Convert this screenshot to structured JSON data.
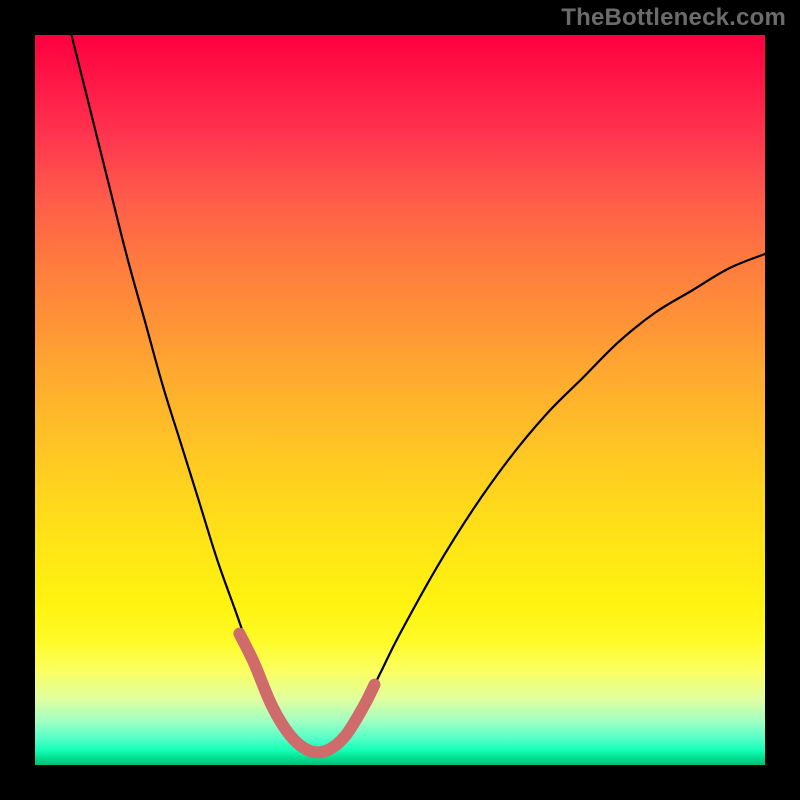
{
  "watermark": "TheBottleneck.com",
  "chart_data": {
    "type": "line",
    "title": "",
    "xlabel": "",
    "ylabel": "",
    "xlim": [
      0,
      100
    ],
    "ylim": [
      0,
      100
    ],
    "grid": false,
    "legend": false,
    "description": "Bottleneck percentage curve: V-shaped curve that dips to near 0% at the optimum around x≈37.5 and rises steeply on both sides. Background is a vertical red→yellow→green gradient (red at top = high bottleneck, green at bottom = low bottleneck). A thick salmon overlay highlights the near-optimal flat region roughly between x≈30 and x≈45.",
    "series": [
      {
        "name": "bottleneck-curve",
        "x": [
          5,
          7.5,
          10,
          12.5,
          15,
          17.5,
          20,
          22.5,
          25,
          27.5,
          30,
          32.5,
          35,
          37.5,
          40,
          42.5,
          45,
          47.5,
          50,
          55,
          60,
          65,
          70,
          75,
          80,
          85,
          90,
          95,
          100
        ],
        "y": [
          100,
          90,
          80,
          70,
          61,
          52,
          44,
          36,
          28,
          21,
          14,
          8,
          4,
          2,
          2,
          4,
          8,
          13,
          18,
          27,
          35,
          42,
          48,
          53,
          58,
          62,
          65,
          68,
          70
        ]
      },
      {
        "name": "optimal-zone-highlight",
        "x": [
          28,
          30,
          32.5,
          35,
          37.5,
          40,
          42.5,
          45,
          46.5
        ],
        "y": [
          18,
          14,
          8,
          4,
          2,
          2,
          4,
          8,
          11
        ]
      }
    ],
    "colors": {
      "curve": "#000000",
      "highlight": "#cf6b6b",
      "gradient_top": "#ff0040",
      "gradient_mid": "#ffe516",
      "gradient_bottom": "#00bf76"
    }
  }
}
